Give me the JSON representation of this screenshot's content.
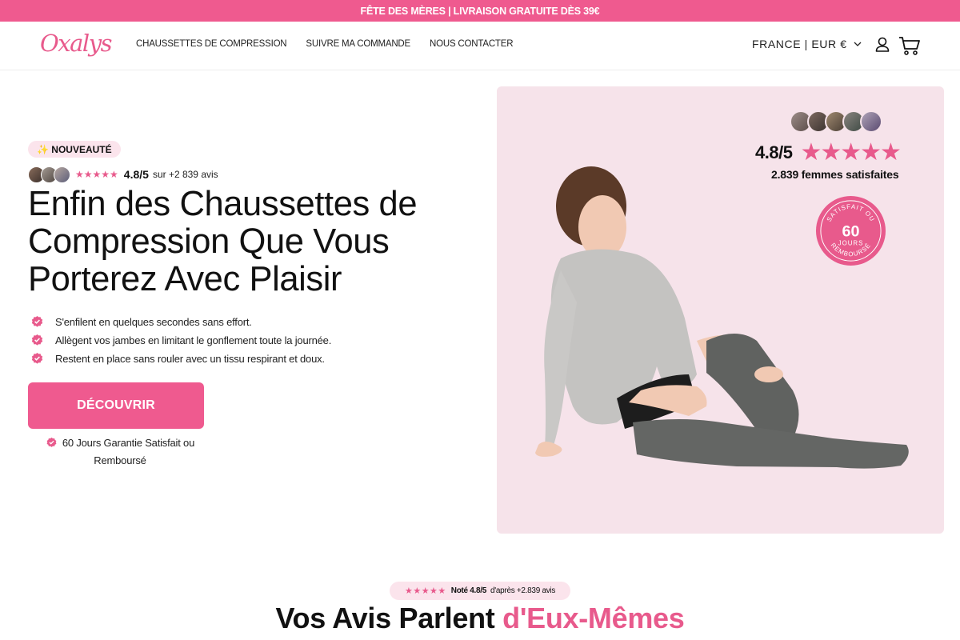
{
  "announcement": {
    "text": "FÊTE DES MÈRES | LIVRAISON GRATUITE DÈS 39€"
  },
  "header": {
    "logo": "Oxalys",
    "nav": [
      {
        "label": "CHAUSSETTES DE COMPRESSION"
      },
      {
        "label": "SUIVRE MA COMMANDE"
      },
      {
        "label": "NOUS CONTACTER"
      }
    ],
    "locale": "FRANCE | EUR €",
    "icons": [
      "chevron-down-icon",
      "user-icon",
      "cart-icon"
    ]
  },
  "hero": {
    "badge": "✨ NOUVEAUTÉ",
    "rating": {
      "stars": "★★★★★",
      "value": "4.8/5",
      "text": "sur +2 839 avis"
    },
    "headline": "Enfin des Chaussettes de Compression Que Vous Porterez Avec Plaisir",
    "benefits": [
      "S'enfilent en quelques secondes sans effort.",
      "Allègent vos jambes en limitant le gonflement toute la journée.",
      "Restent en place sans rouler avec un tissu respirant et doux."
    ],
    "cta": "DÉCOUVRIR",
    "guarantee": "60 Jours Garantie Satisfait ou Remboursé"
  },
  "media": {
    "score": "4.8/5",
    "stars": "★★★★★",
    "subtitle": "2.839 femmes satisfaites",
    "seal": {
      "top": "SATISFAIT OU",
      "number": "60",
      "mid": "JOURS",
      "bottom": "REMBOURSÉ"
    }
  },
  "reviews": {
    "pill": {
      "stars": "★★★★★",
      "note": "Noté 4.8/5",
      "text": "d'après +2.839 avis"
    },
    "title_plain": "Vos Avis Parlent ",
    "title_accent": "d'Eux-Mêmes"
  },
  "colors": {
    "brand_pink": "#ef5a8f",
    "accent_pink": "#e85a8c",
    "media_bg": "#f6e3ea",
    "pill_bg": "#fbe4ec"
  }
}
